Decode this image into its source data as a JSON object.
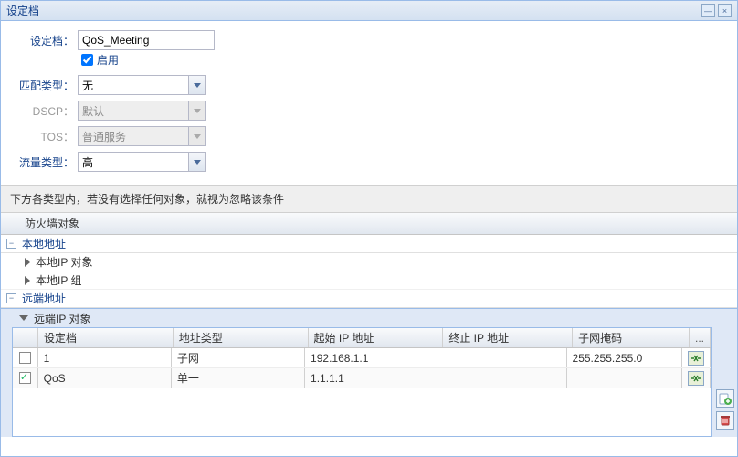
{
  "window": {
    "title": "设定档",
    "minimize": "—",
    "close": "×"
  },
  "form": {
    "profile_label": "设定档：",
    "profile_value": "QoS_Meeting",
    "enable_label": "启用",
    "match_type_label": "匹配类型：",
    "match_type_value": "无",
    "dscp_label": "DSCP：",
    "dscp_value": "默认",
    "tos_label": "TOS：",
    "tos_value": "普通服务",
    "traffic_type_label": "流量类型：",
    "traffic_type_value": "高"
  },
  "hint": "下方各类型内，若没有选择任何对象，就视为忽略该条件",
  "firewall_group": "防火墙对象",
  "sections": {
    "local": "本地地址",
    "local_ip_obj": "本地IP 对象",
    "local_ip_group": "本地IP 组",
    "remote": "远端地址",
    "remote_ip_obj": "远端IP 对象"
  },
  "table": {
    "headers": {
      "profile": "设定档",
      "addr_type": "地址类型",
      "start_ip": "起始 IP 地址",
      "end_ip": "终止 IP 地址",
      "mask": "子网掩码",
      "actions": "..."
    },
    "rows": [
      {
        "checked": false,
        "profile": "1",
        "addr_type": "子网",
        "start_ip": "192.168.1.1",
        "end_ip": "",
        "mask": "255.255.255.0"
      },
      {
        "checked": true,
        "profile": "QoS",
        "addr_type": "单一",
        "start_ip": "1.1.1.1",
        "end_ip": "",
        "mask": ""
      }
    ]
  }
}
